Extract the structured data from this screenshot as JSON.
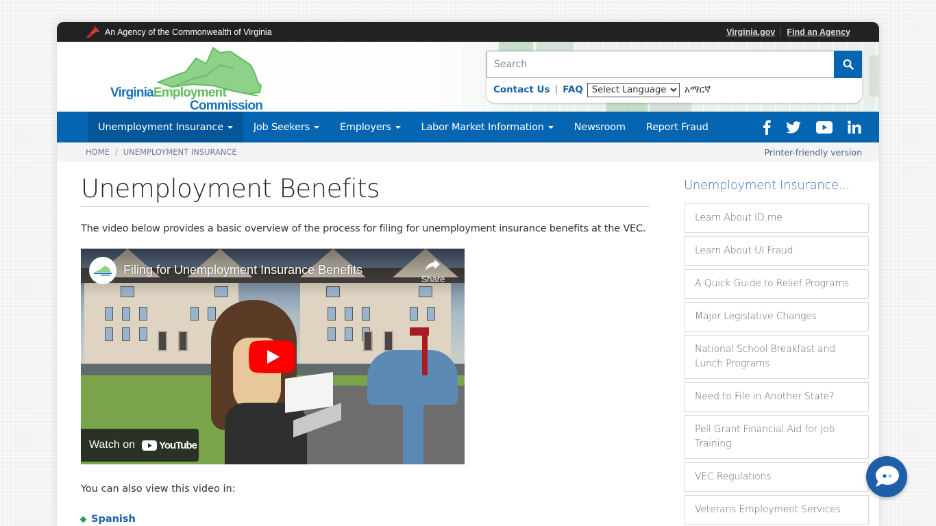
{
  "topbar": {
    "agency_text": "An Agency of the Commonwealth of Virginia",
    "links": [
      "Virginia.gov",
      "Find an Agency"
    ]
  },
  "header": {
    "logo_line1_a": "Virginia",
    "logo_line1_b": "Employment",
    "logo_line2": "Commission",
    "search": {
      "placeholder": "Search",
      "value": ""
    },
    "contact_label": "Contact Us",
    "faq_label": "FAQ",
    "language_select": {
      "selected": "Select Language"
    },
    "amharic_label": "አማርኛ"
  },
  "nav": {
    "items": [
      {
        "label": "Unemployment Insurance",
        "dropdown": true,
        "active": true
      },
      {
        "label": "Job Seekers",
        "dropdown": true
      },
      {
        "label": "Employers",
        "dropdown": true
      },
      {
        "label": "Labor Market Information",
        "dropdown": true
      },
      {
        "label": "Newsroom",
        "dropdown": false
      },
      {
        "label": "Report Fraud",
        "dropdown": false
      }
    ],
    "social": [
      "facebook-icon",
      "twitter-icon",
      "youtube-icon",
      "linkedin-icon"
    ]
  },
  "breadcrumb": {
    "items": [
      "HOME",
      "UNEMPLOYMENT INSURANCE"
    ],
    "printer_label": "Printer-friendly version"
  },
  "main": {
    "title": "Unemployment Benefits",
    "intro": "The video below provides a basic overview of the process for filing for unemployment insurance benefits at the VEC.",
    "video": {
      "title": "Filing for Unemployment Insurance Benefits",
      "share_label": "Share",
      "watch_on_label": "Watch on",
      "youtube_label": "YouTube"
    },
    "also_text": "You can also view this video in:",
    "languages": [
      "Spanish"
    ]
  },
  "sidebar": {
    "title": "Unemployment Insurance...",
    "items": [
      "Learn About ID.me",
      "Learn About UI Fraud",
      "A Quick Guide to Relief Programs",
      "Major Legislative Changes",
      "National School Breakfast and Lunch Programs",
      "Need to File in Another State?",
      "Pell Grant Financial Aid for Job Training",
      "VEC Regulations",
      "Veterans Employment Services"
    ]
  },
  "colors": {
    "nav_blue": "#0665b1",
    "nav_active": "#04569a",
    "link_blue": "#1b5faa",
    "topbar": "#222222",
    "chat": "#1e5fa8"
  }
}
